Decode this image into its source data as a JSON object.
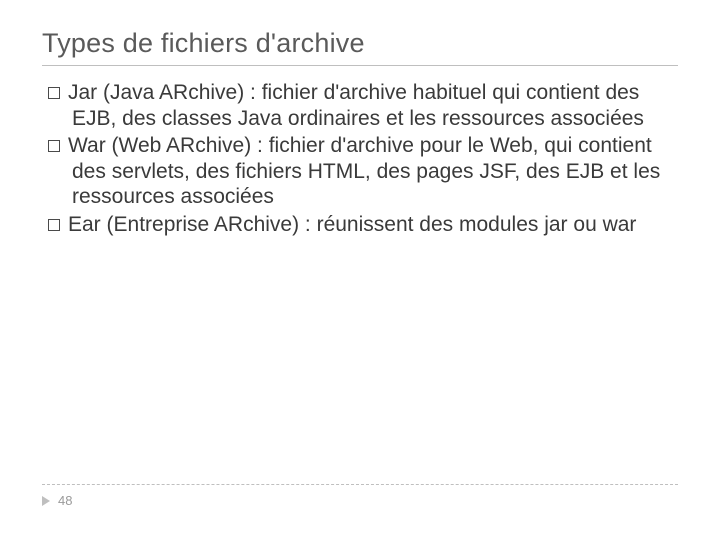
{
  "title": "Types de fichiers d'archive",
  "items": [
    "Jar (Java ARchive) : fichier d'archive habituel qui contient des EJB, des classes Java ordinaires et les ressources associées",
    "War (Web ARchive) : fichier d'archive pour le Web, qui contient des servlets, des fichiers HTML, des pages JSF, des EJB et les ressources associées",
    "Ear (Entreprise ARchive) : réunissent des modules jar ou war"
  ],
  "page_number": "48"
}
